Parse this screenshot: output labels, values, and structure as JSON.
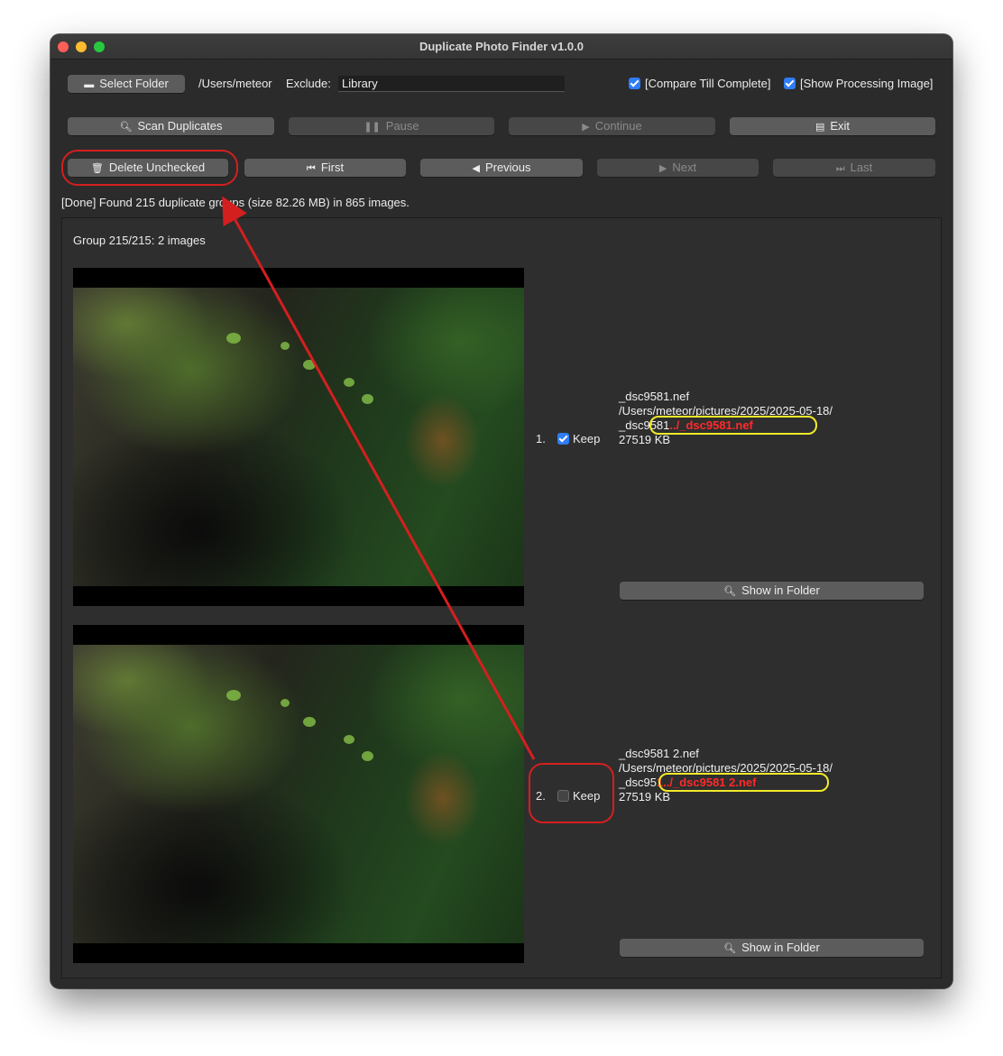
{
  "window": {
    "title": "Duplicate Photo Finder v1.0.0"
  },
  "toolbar": {
    "select_folder_label": "Select Folder",
    "folder_path": "/Users/meteor",
    "exclude_label": "Exclude:",
    "exclude_value": "Library",
    "compare_till_complete": {
      "label": "[Compare Till Complete]",
      "checked": true
    },
    "show_processing_image": {
      "label": "[Show Processing Image]",
      "checked": true
    }
  },
  "actions": {
    "scan_duplicates": "Scan Duplicates",
    "pause": "Pause",
    "continue": "Continue",
    "exit": "Exit"
  },
  "navigation": {
    "delete_unchecked": "Delete Unchecked",
    "first": "First",
    "previous": "Previous",
    "next": "Next",
    "last": "Last"
  },
  "status": "[Done] Found 215 duplicate groups (size 82.26 MB) in 865 images.",
  "group": {
    "header": "Group 215/215: 2 images",
    "items": [
      {
        "index": "1.",
        "keep_label": "Keep",
        "keep_checked": true,
        "filename": "_dsc9581.nef",
        "folder": "/Users/meteor/pictures/2025/2025-05-18/",
        "path_line_prefix": "_dsc9581",
        "path_line_annotation": "../_dsc9581.nef",
        "size": "27519 KB",
        "show_in_folder": "Show in Folder"
      },
      {
        "index": "2.",
        "keep_label": "Keep",
        "keep_checked": false,
        "filename": "_dsc9581 2.nef",
        "folder": "/Users/meteor/pictures/2025/2025-05-18/",
        "path_line_prefix": "_dsc95",
        "path_line_annotation": "1../_dsc9581 2.nef",
        "size": "27519 KB",
        "show_in_folder": "Show in Folder"
      }
    ]
  },
  "colors": {
    "annotation_red": "#d41f1f",
    "annotation_yellow": "#f2ea2a",
    "checkbox_blue": "#2e7cf6"
  }
}
